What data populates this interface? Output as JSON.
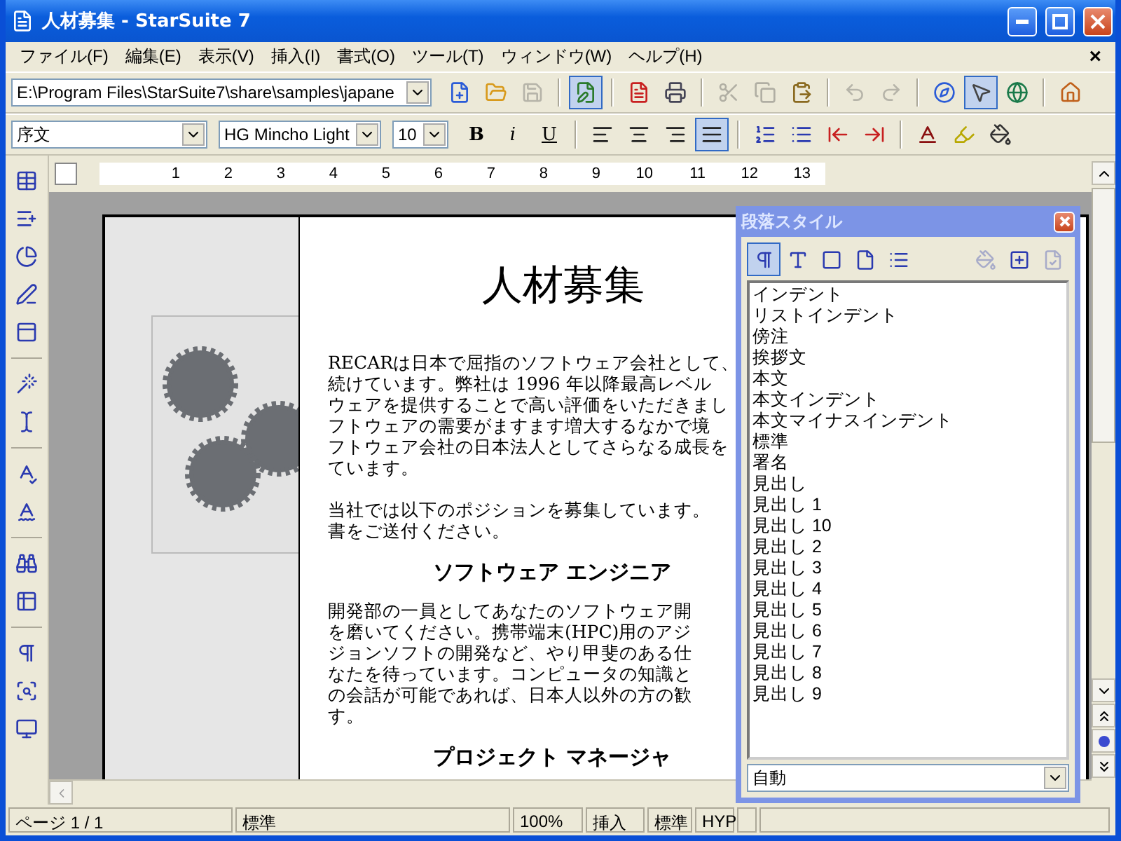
{
  "window": {
    "title": "人材募集 - StarSuite 7"
  },
  "menu": {
    "items": [
      "ファイル(F)",
      "編集(E)",
      "表示(V)",
      "挿入(I)",
      "書式(O)",
      "ツール(T)",
      "ウィンドウ(W)",
      "ヘルプ(H)"
    ],
    "close": "×"
  },
  "toolbar": {
    "path": "E:\\Program Files\\StarSuite7\\share\\samples\\japane",
    "buttons": [
      {
        "selected": false,
        "disabled": false
      },
      {
        "selected": false,
        "disabled": false
      },
      {
        "selected": false,
        "disabled": true
      },
      {
        "selected": true,
        "disabled": false
      },
      {
        "selected": false,
        "disabled": false
      },
      {
        "selected": false,
        "disabled": false
      },
      {
        "selected": false,
        "disabled": true
      },
      {
        "selected": false,
        "disabled": true
      },
      {
        "selected": false,
        "disabled": false
      },
      {
        "selected": false,
        "disabled": true
      },
      {
        "selected": false,
        "disabled": true
      },
      {
        "selected": false,
        "disabled": false
      },
      {
        "selected": true,
        "disabled": false
      },
      {
        "selected": false,
        "disabled": false
      },
      {
        "selected": false,
        "disabled": false
      }
    ]
  },
  "format_bar": {
    "style": "序文",
    "font": "HG Mincho Light",
    "size": "10",
    "text_buttons": [
      {
        "label": "B",
        "selected": false
      },
      {
        "label": "i",
        "selected": false
      },
      {
        "label": "U",
        "selected": false
      }
    ],
    "buttons": [
      {
        "selected": false
      },
      {
        "selected": false
      },
      {
        "selected": false
      },
      {
        "selected": true
      },
      {
        "selected": false
      },
      {
        "selected": false
      },
      {
        "selected": false
      },
      {
        "selected": false
      },
      {
        "selected": false
      },
      {
        "selected": false
      },
      {
        "selected": false
      }
    ]
  },
  "ruler": {
    "ticks": [
      "1",
      "2",
      "3",
      "4",
      "5",
      "6",
      "7",
      "8",
      "9",
      "10",
      "11",
      "12",
      "13"
    ]
  },
  "document": {
    "title": "人材募集",
    "paragraphs": [
      [
        "RECARは日本で屈指のソフトウェア会社として、",
        "続けています。弊社は 1996 年以降最高レベル",
        "ウェアを提供することで高い評価をいただきまし",
        "フトウェアの需要がますます増大するなかで境",
        "フトウェア会社の日本法人としてさらなる成長を",
        "ています。"
      ],
      [
        "当社では以下のポジションを募集しています。",
        "書をご送付ください。"
      ]
    ],
    "sections": [
      {
        "heading": "ソフトウェア エンジニア",
        "lines": [
          "開発部の一員としてあなたのソフトウェア開",
          "を磨いてください。携帯端末(HPC)用のアジ",
          "ジョンソフトの開発など、やり甲斐のある仕",
          "なたを待っています。コンピュータの知識と",
          "の会話が可能であれば、日本人以外の方の歓",
          "す。"
        ]
      },
      {
        "heading": "プロジェクト マネージャ"
      }
    ]
  },
  "stylist": {
    "title": "段落スタイル",
    "buttons": [
      {
        "selected": true,
        "disabled": false
      },
      {
        "selected": false,
        "disabled": false
      },
      {
        "selected": false,
        "disabled": false
      },
      {
        "selected": false,
        "disabled": false
      },
      {
        "selected": false,
        "disabled": false
      },
      {
        "selected": false,
        "disabled": true
      },
      {
        "selected": false,
        "disabled": false
      },
      {
        "selected": false,
        "disabled": true
      }
    ],
    "items": [
      "インデント",
      "リストインデント",
      "傍注",
      "挨拶文",
      "本文",
      "本文インデント",
      "本文マイナスインデント",
      "標準",
      "署名",
      "見出し",
      "見出し 1",
      "見出し 10",
      "見出し 2",
      "見出し 3",
      "見出し 4",
      "見出し 5",
      "見出し 6",
      "見出し 7",
      "見出し 8",
      "見出し 9"
    ],
    "filter": "自動"
  },
  "status_bar": [
    "ページ 1 / 1",
    "標準",
    "100%",
    "挿入",
    "標準",
    "HYP"
  ]
}
